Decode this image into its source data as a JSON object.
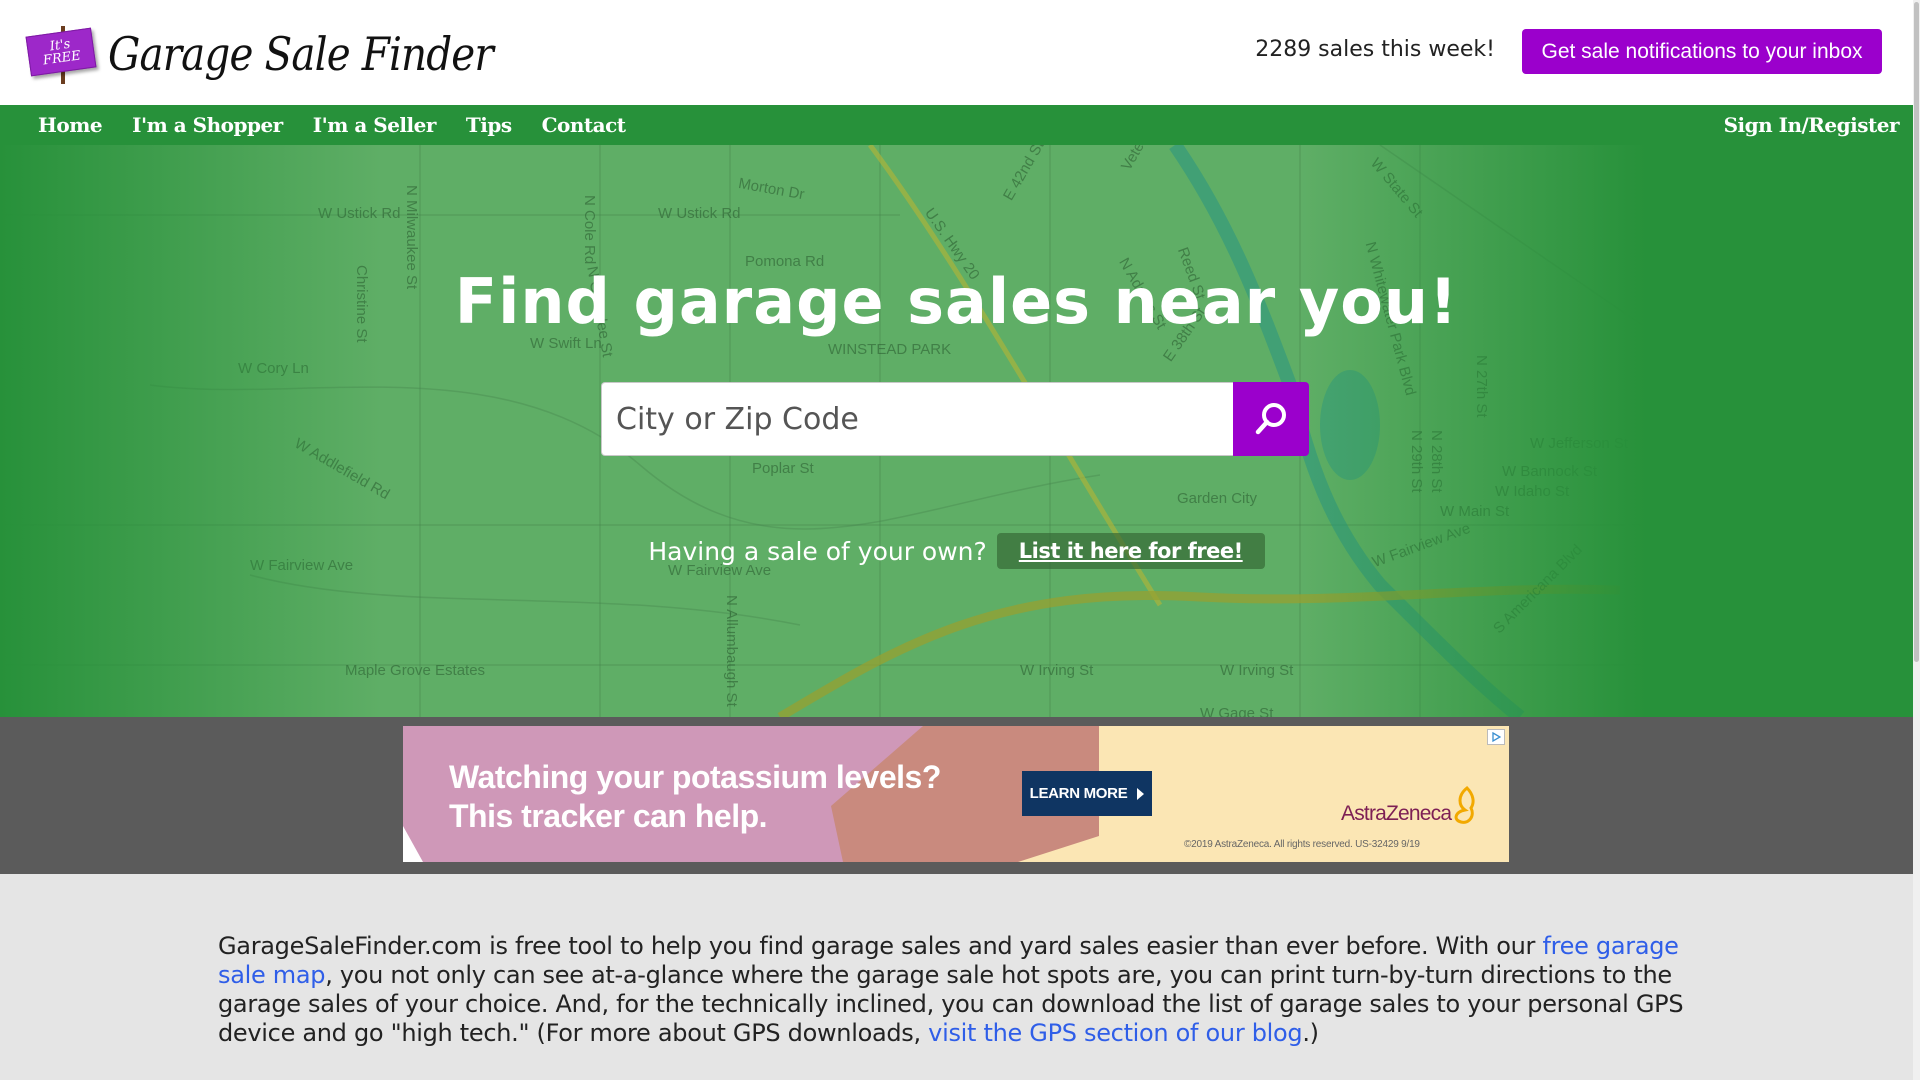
{
  "header": {
    "logo_sign_line1": "It's",
    "logo_sign_line2": "FREE",
    "logo_text": "Garage Sale Finder",
    "sales_count_text": "2289 sales this week!",
    "notify_button": "Get sale notifications to your inbox"
  },
  "nav": {
    "items": [
      {
        "label": "Home"
      },
      {
        "label": "I'm a Shopper"
      },
      {
        "label": "I'm a Seller"
      },
      {
        "label": "Tips"
      },
      {
        "label": "Contact"
      }
    ],
    "sign_in": "Sign In/Register"
  },
  "hero": {
    "title": "Find garage sales near you!",
    "search_placeholder": "City or Zip Code",
    "search_value": "",
    "search_icon": "search-icon",
    "sale_question": "Having a sale of your own?",
    "list_button": "List it here for free!",
    "map_labels": [
      "W Ustick Rd",
      "W Ustick Rd",
      "N Milwaukee St",
      "N Cole Rd",
      "Morton Dr",
      "Pomona Rd",
      "W Swift Ln",
      "WINSTEAD PARK",
      "N Grandee St",
      "Christine St",
      "W Cory Ln",
      "W Addlefield Rd",
      "Poplar St",
      "Garden City",
      "W Main St",
      "W Jefferson St",
      "W Bannock St",
      "W Idaho St",
      "N 27th St",
      "N 28th St",
      "N 29th St",
      "W Fairview Ave",
      "W Fairview Ave",
      "W Fairview Ave",
      "Maple Grove Estates",
      "N Allumbaugh St",
      "W Irving St",
      "W Irving St",
      "W State St",
      "N Whitewater Park Blvd",
      "Veterans",
      "U.S. Hwy 20",
      "W Gage St",
      "S Americana Blvd",
      "Reed St",
      "N Adams St",
      "E 38th St",
      "E 42nd St"
    ]
  },
  "ad": {
    "headline_line1": "Watching your potassium levels?",
    "headline_line2": "This tracker can help.",
    "cta": "LEARN MORE",
    "brand": "AstraZeneca",
    "legal": "©2019 AstraZeneca. All rights reserved. US-32429 9/19",
    "colors": {
      "pink": "#cf98b8",
      "rose": "#c98a7e",
      "cream": "#fbe6b4",
      "navy": "#0f3562",
      "brand": "#7d1f54",
      "mark": "#f2a900"
    }
  },
  "content": {
    "p1": "GarageSaleFinder.com is free tool to help you find garage sales and yard sales easier than ever before. With our ",
    "link1": "free garage sale map",
    "p2": ", you not only can see at-a-glance where the garage sale hot spots are, you can print turn-by-turn directions to the garage sales of your choice. And, for the technically inclined, you can download the list of garage sales to your personal GPS device and go \"high tech.\" (For more about GPS downloads, ",
    "link2": "visit the GPS section of our blog",
    "p3": ".)"
  },
  "colors": {
    "nav_green": "#27913a",
    "purple": "#9b00cc",
    "link_blue": "#2f5ee8",
    "ad_band": "#5b5b5b",
    "body_bg": "#e5e5e5"
  }
}
